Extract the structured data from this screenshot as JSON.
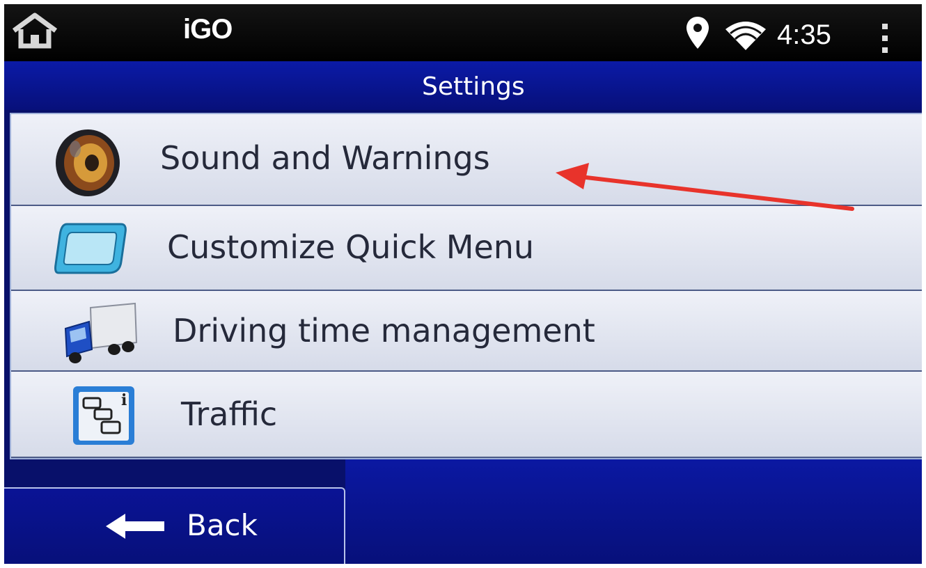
{
  "status_bar": {
    "app_title": "iGO",
    "clock": "4:35",
    "icons": [
      "home-icon",
      "location-icon",
      "wifi-icon",
      "overflow-menu-icon"
    ]
  },
  "header": {
    "title": "Settings"
  },
  "menu": {
    "items": [
      {
        "label": "Sound and Warnings",
        "icon": "speaker-icon"
      },
      {
        "label": "Customize Quick Menu",
        "icon": "quick-menu-icon"
      },
      {
        "label": "Driving time management",
        "icon": "truck-icon"
      },
      {
        "label": "Traffic",
        "icon": "traffic-icon"
      }
    ]
  },
  "footer": {
    "back_label": "Back",
    "back_icon": "arrow-left-icon"
  },
  "colors": {
    "header_blue": "#0b1aa7",
    "list_item_bg": "#e6e9f3",
    "annotation_arrow": "#e8332b"
  }
}
